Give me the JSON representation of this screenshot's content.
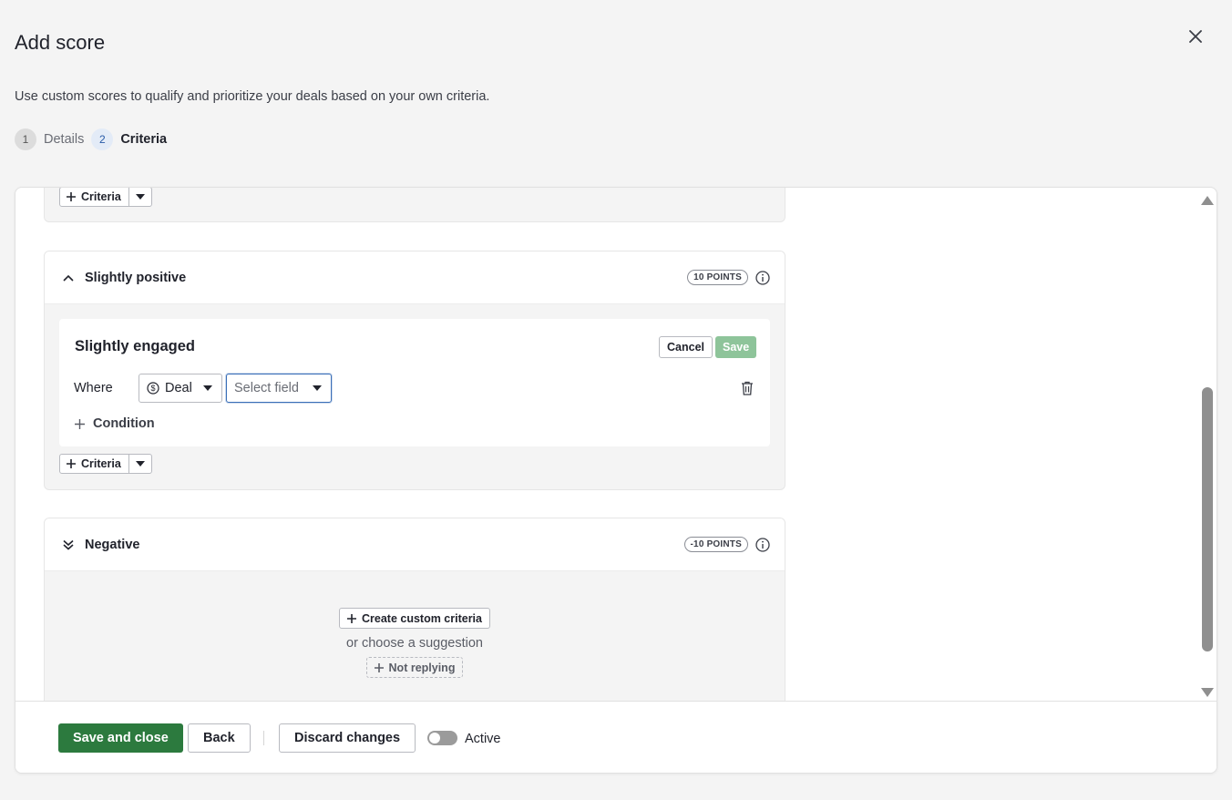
{
  "modal": {
    "title": "Add score",
    "description": "Use custom scores to qualify and prioritize your deals based on your own criteria."
  },
  "steps": [
    {
      "number": "1",
      "label": "Details",
      "state": "done"
    },
    {
      "number": "2",
      "label": "Criteria",
      "state": "active"
    }
  ],
  "top_section": {
    "criteria_button": "Criteria"
  },
  "slightly_positive": {
    "name": "Slightly positive",
    "points": "10 POINTS",
    "rule": {
      "name": "Slightly engaged",
      "cancel_label": "Cancel",
      "save_label": "Save",
      "where_label": "Where",
      "entity_select": "Deal",
      "field_select_placeholder": "Select field",
      "add_condition_label": "Condition"
    },
    "criteria_button": "Criteria"
  },
  "negative": {
    "name": "Negative",
    "points": "-10 POINTS",
    "create_label": "Create custom criteria",
    "or_text": "or choose a suggestion",
    "suggestion": "Not replying"
  },
  "footer": {
    "save_close_label": "Save and close",
    "back_label": "Back",
    "discard_label": "Discard changes",
    "active_label": "Active",
    "active_on": false
  },
  "colors": {
    "primary": "#2c7a3e",
    "save_disabled": "#8ec49a",
    "focus": "#3b6fb8"
  }
}
